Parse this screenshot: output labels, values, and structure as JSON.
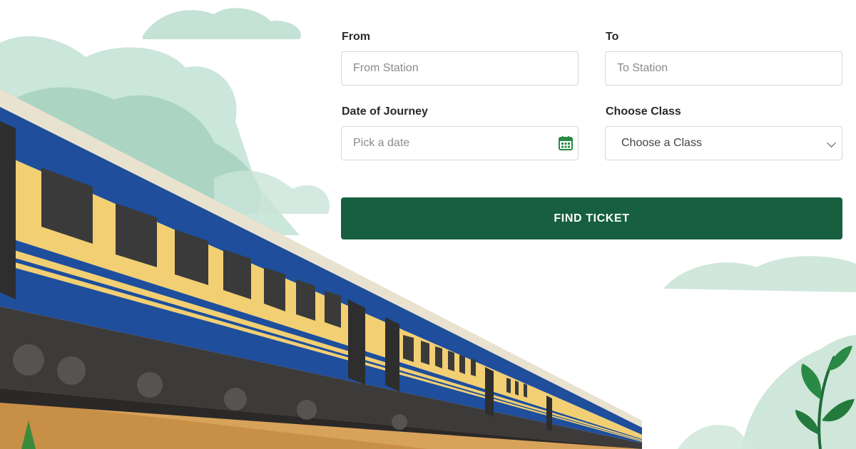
{
  "form": {
    "from": {
      "label": "From",
      "placeholder": "From Station"
    },
    "to": {
      "label": "To",
      "placeholder": "To Station"
    },
    "date": {
      "label": "Date of Journey",
      "placeholder": "Pick a date"
    },
    "class": {
      "label": "Choose Class",
      "selected": "Choose a Class"
    },
    "submit_label": "FIND TICKET"
  },
  "icons": {
    "date_picker": "calendar-icon",
    "class_dropdown": "chevron-down-icon"
  },
  "colors": {
    "brand_green": "#17603f",
    "train_blue": "#1e4e9c",
    "train_yellow": "#f2cf73",
    "foliage_mint": "#a9d3c2"
  }
}
